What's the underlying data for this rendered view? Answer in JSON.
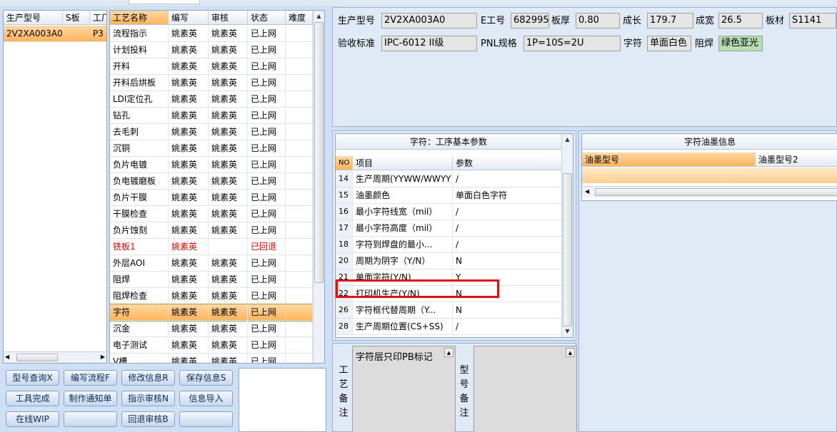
{
  "model_list": {
    "columns": [
      "生产型号",
      "S板",
      "工厂"
    ],
    "rows": [
      {
        "model": "2V2XA003A0",
        "s": "",
        "f": "P3"
      }
    ]
  },
  "process_list": {
    "columns": [
      "工艺名称",
      "编写",
      "审核",
      "状态",
      "难度"
    ],
    "rows": [
      {
        "name": "流程指示",
        "writer": "姚素英",
        "auditor": "姚素英",
        "status": "已上网",
        "red": false,
        "selected": false
      },
      {
        "name": "计划投料",
        "writer": "姚素英",
        "auditor": "姚素英",
        "status": "已上网",
        "red": false,
        "selected": false
      },
      {
        "name": "开料",
        "writer": "姚素英",
        "auditor": "姚素英",
        "status": "已上网",
        "red": false,
        "selected": false
      },
      {
        "name": "开料后烘板",
        "writer": "姚素英",
        "auditor": "姚素英",
        "status": "已上网",
        "red": false,
        "selected": false
      },
      {
        "name": "LDI定位孔",
        "writer": "姚素英",
        "auditor": "姚素英",
        "status": "已上网",
        "red": false,
        "selected": false
      },
      {
        "name": "钻孔",
        "writer": "姚素英",
        "auditor": "姚素英",
        "status": "已上网",
        "red": false,
        "selected": false
      },
      {
        "name": "去毛刺",
        "writer": "姚素英",
        "auditor": "姚素英",
        "status": "已上网",
        "red": false,
        "selected": false
      },
      {
        "name": "沉铜",
        "writer": "姚素英",
        "auditor": "姚素英",
        "status": "已上网",
        "red": false,
        "selected": false
      },
      {
        "name": "负片电镀",
        "writer": "姚素英",
        "auditor": "姚素英",
        "status": "已上网",
        "red": false,
        "selected": false
      },
      {
        "name": "负电镀磨板",
        "writer": "姚素英",
        "auditor": "姚素英",
        "status": "已上网",
        "red": false,
        "selected": false
      },
      {
        "name": "负片干膜",
        "writer": "姚素英",
        "auditor": "姚素英",
        "status": "已上网",
        "red": false,
        "selected": false
      },
      {
        "name": "干膜检查",
        "writer": "姚素英",
        "auditor": "姚素英",
        "status": "已上网",
        "red": false,
        "selected": false
      },
      {
        "name": "负片蚀刻",
        "writer": "姚素英",
        "auditor": "姚素英",
        "status": "已上网",
        "red": false,
        "selected": false
      },
      {
        "name": "铣板1",
        "writer": "姚素英",
        "auditor": "",
        "status": "已回退",
        "red": true,
        "selected": false
      },
      {
        "name": "外层AOI",
        "writer": "姚素英",
        "auditor": "姚素英",
        "status": "已上网",
        "red": false,
        "selected": false
      },
      {
        "name": "阻焊",
        "writer": "姚素英",
        "auditor": "姚素英",
        "status": "已上网",
        "red": false,
        "selected": false
      },
      {
        "name": "阻焊检查",
        "writer": "姚素英",
        "auditor": "姚素英",
        "status": "已上网",
        "red": false,
        "selected": false
      },
      {
        "name": "字符",
        "writer": "姚素英",
        "auditor": "姚素英",
        "status": "已上网",
        "red": false,
        "selected": true
      },
      {
        "name": "沉金",
        "writer": "姚素英",
        "auditor": "姚素英",
        "status": "已上网",
        "red": false,
        "selected": false
      },
      {
        "name": "电子测试",
        "writer": "姚素英",
        "auditor": "姚素英",
        "status": "已上网",
        "red": false,
        "selected": false
      },
      {
        "name": "V槽",
        "writer": "姚素英",
        "auditor": "姚素英",
        "status": "已上网",
        "red": false,
        "selected": false
      }
    ]
  },
  "buttons": [
    [
      "型号查询X",
      "编写流程F",
      "修改信息R",
      "保存信息S"
    ],
    [
      "工具完成",
      "制作通知单",
      "指示审核N",
      "信息导入"
    ],
    [
      "在线WIP",
      "",
      "回退审核B",
      ""
    ]
  ],
  "info": {
    "model_label": "生产型号",
    "model_value": "2V2XA003A0",
    "eng_label": "E工号",
    "eng_value": "682995",
    "thick_label": "板厚",
    "thick_value": "0.80",
    "grow_label": "成长",
    "grow_value": "179.7",
    "width_label": "成宽",
    "width_value": "26.5",
    "material_label": "板材",
    "material_value": "S1141",
    "std_label": "验收标准",
    "std_value": "IPC-6012 II级",
    "pnl_label": "PNL规格",
    "pnl_value": "1P=10S=2U",
    "char_label": "字符",
    "char_value": "单面白色",
    "mask_label": "阻焊",
    "mask_value": "绿色亚光"
  },
  "params_panel": {
    "title": "字符：工序基本参数",
    "columns": [
      "NO",
      "项目",
      "参数"
    ],
    "rows": [
      {
        "no": "14",
        "item": "生产周期(YYWW/WWYY)",
        "value": "/"
      },
      {
        "no": "15",
        "item": "油墨颜色",
        "value": "单面白色字符"
      },
      {
        "no": "16",
        "item": "最小字符线宽（mil）",
        "value": "/"
      },
      {
        "no": "17",
        "item": "最小字符高度（mil）",
        "value": "/"
      },
      {
        "no": "18",
        "item": "字符到焊盘的最小...",
        "value": "/"
      },
      {
        "no": "20",
        "item": "周期为阴字（Y/N）",
        "value": "N"
      },
      {
        "no": "21",
        "item": "单面字符(Y/N)",
        "value": "Y"
      },
      {
        "no": "22",
        "item": "打印机生产(Y/N)",
        "value": "N"
      },
      {
        "no": "26",
        "item": "字符框代替周期（Y...",
        "value": "N"
      },
      {
        "no": "28",
        "item": "生产周期位置(CS+SS)",
        "value": "/"
      }
    ]
  },
  "ink_panel": {
    "title": "字符油墨信息",
    "columns": [
      "油墨型号",
      "油墨型号2"
    ]
  },
  "memo": {
    "process_label": "工艺备注",
    "process_text": "字符层只印PB标记",
    "model_label": "型号备注",
    "model_text": ""
  },
  "colors": {
    "highlight_box": "#e01010",
    "selection": "#ffb45a",
    "field_green": "#b5ddb0"
  }
}
